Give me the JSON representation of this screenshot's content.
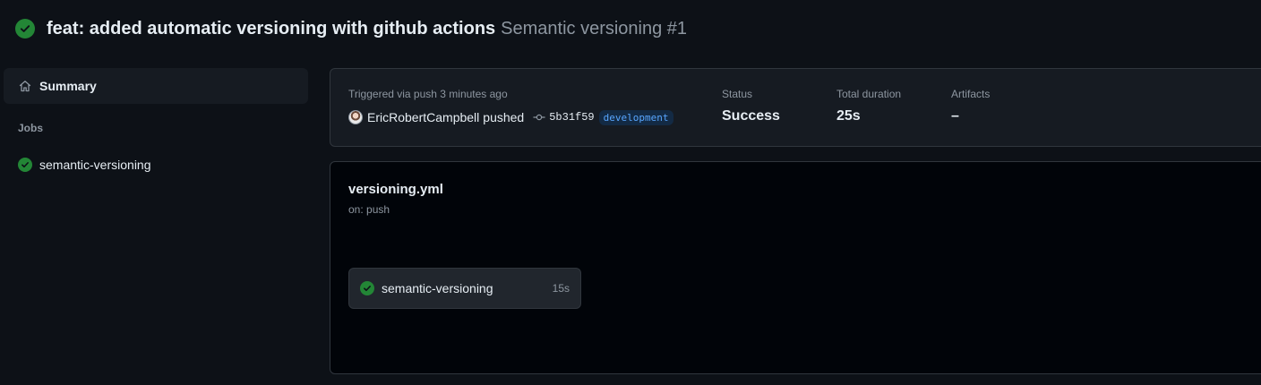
{
  "header": {
    "status_icon": "check-circle-icon",
    "title": "feat: added automatic versioning with github actions",
    "subtitle": "Semantic versioning #1"
  },
  "sidebar": {
    "summary": {
      "label": "Summary",
      "icon": "home-icon"
    },
    "jobs_heading": "Jobs",
    "jobs": [
      {
        "label": "semantic-versioning",
        "icon": "check-circle-icon"
      }
    ]
  },
  "run_info": {
    "trigger_label": "Triggered via push 3 minutes ago",
    "actor": "EricRobertCampbell",
    "action": "pushed",
    "commit_sha": "5b31f59",
    "branch": "development",
    "status_label": "Status",
    "status_value": "Success",
    "duration_label": "Total duration",
    "duration_value": "25s",
    "artifacts_label": "Artifacts",
    "artifacts_value": "–"
  },
  "workflow_graph": {
    "file": "versioning.yml",
    "trigger": "on: push",
    "jobs": [
      {
        "name": "semantic-versioning",
        "duration": "15s",
        "status": "success"
      }
    ]
  },
  "colors": {
    "background": "#0d1117",
    "panel": "#161b22",
    "graph_background": "#010409",
    "border": "#30363d",
    "success": "#238636",
    "muted_text": "#8d96a0",
    "branch_text": "#58a6ff"
  }
}
